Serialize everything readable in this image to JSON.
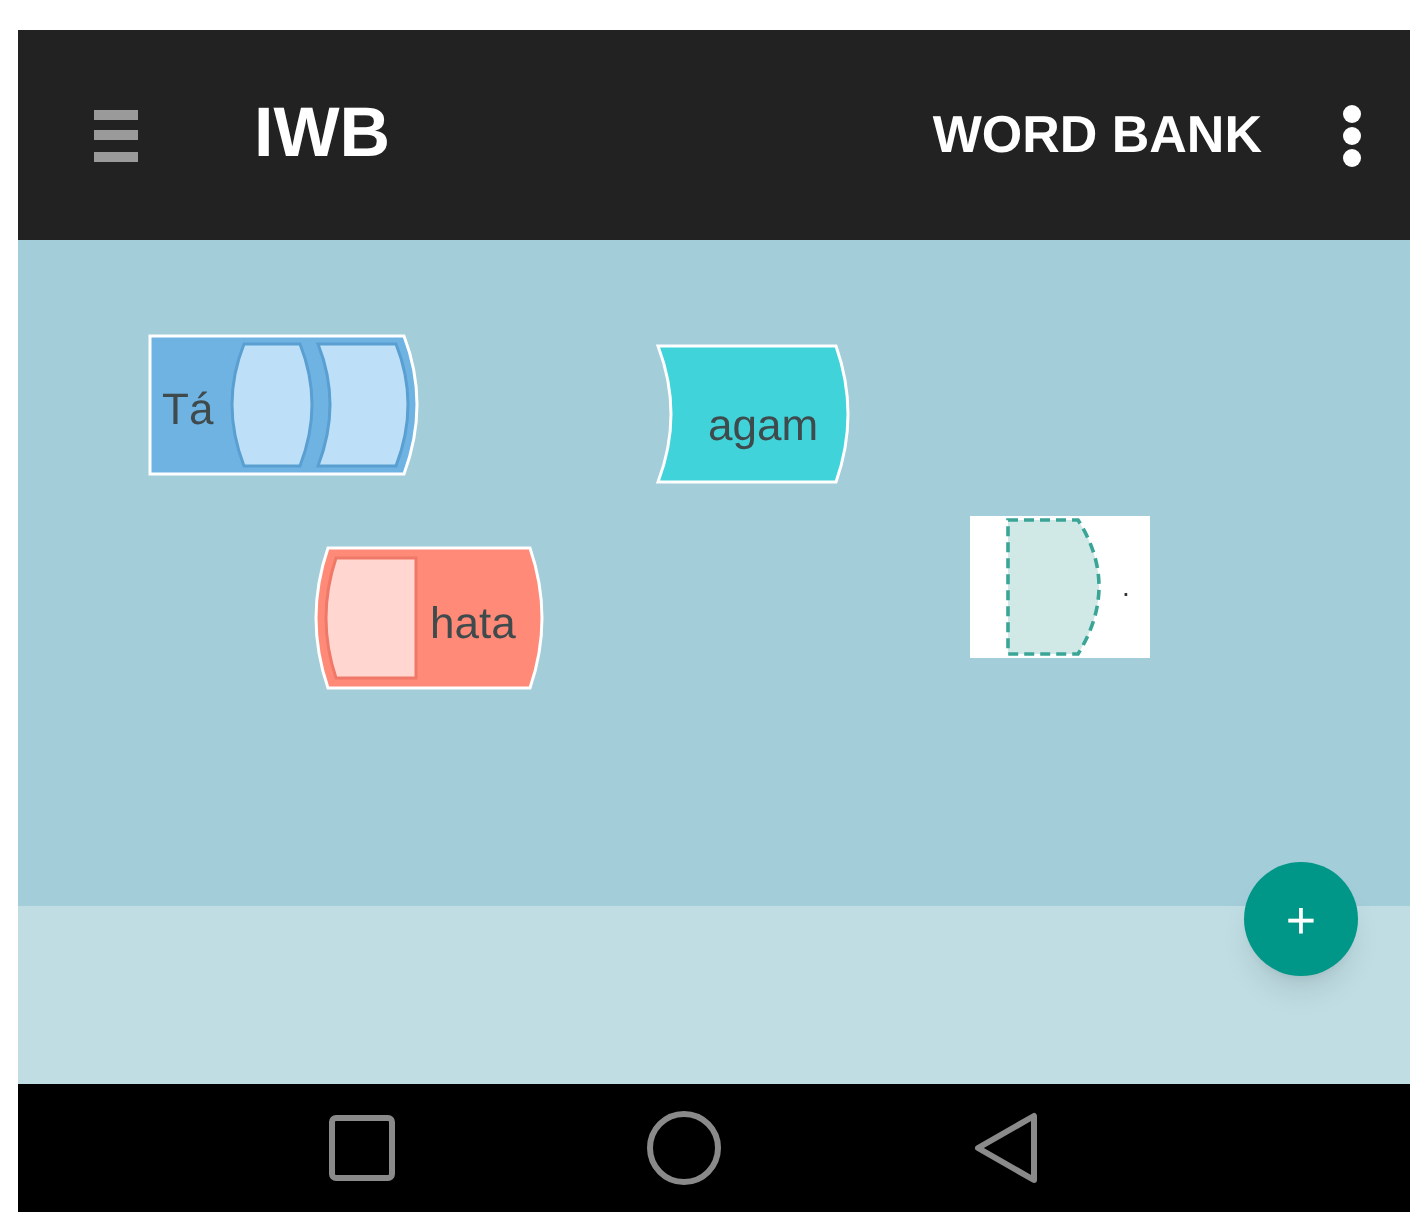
{
  "app_bar": {
    "title": "IWB",
    "action": "WORD BANK"
  },
  "blocks": [
    {
      "kind": "sentence",
      "label": "Tá",
      "color": "#6fb3e3"
    },
    {
      "kind": "word",
      "label": "agam",
      "color": "#41d3da"
    },
    {
      "kind": "phrase",
      "label": "hata",
      "color": "#ff8a78"
    }
  ],
  "drop_target": {
    "label": "."
  },
  "fab": {
    "label": "+"
  }
}
